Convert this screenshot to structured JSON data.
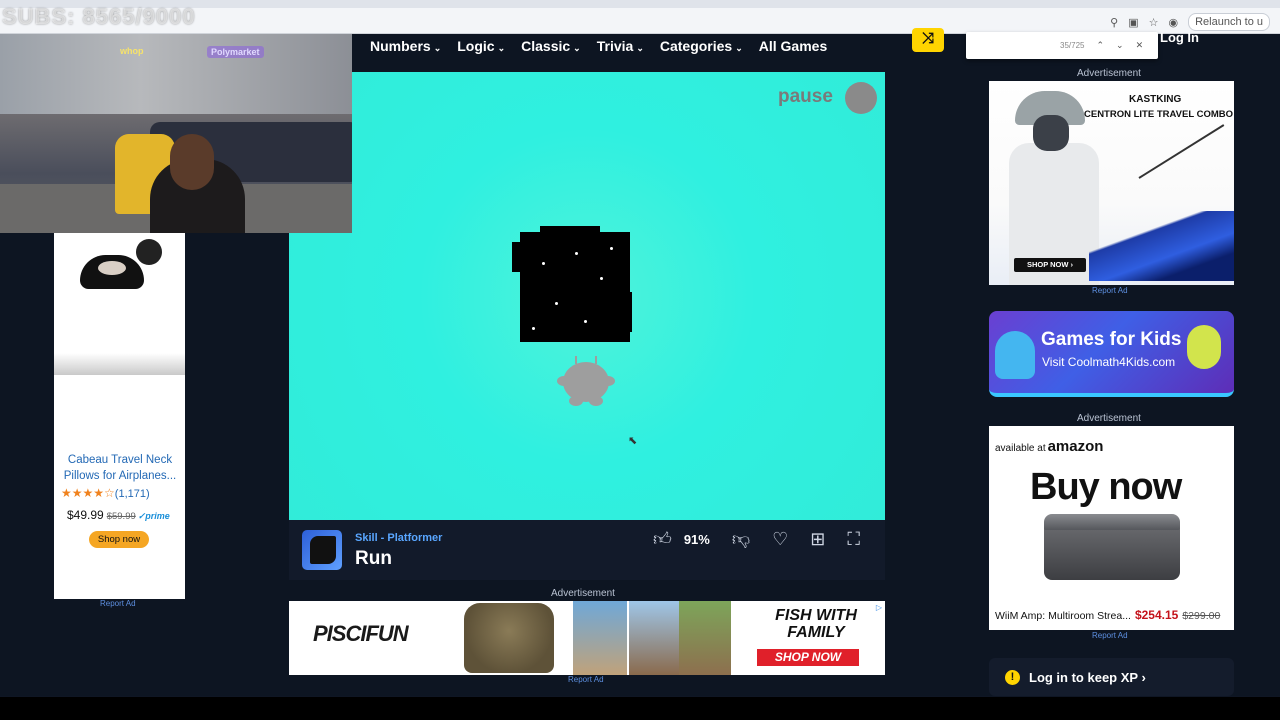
{
  "overlay": {
    "subs_counter": "SUBS: 8565/9000"
  },
  "browser": {
    "relaunch_label": "Relaunch to u",
    "find": {
      "count": "35/725",
      "prev": "⌃",
      "next": "⌄",
      "close": "✕"
    }
  },
  "nav": {
    "items": [
      {
        "label": "Numbers"
      },
      {
        "label": "Logic"
      },
      {
        "label": "Classic"
      },
      {
        "label": "Trivia"
      },
      {
        "label": "Categories"
      },
      {
        "label": "All Games"
      }
    ],
    "shuffle_glyph": "⤨",
    "login": "Log In"
  },
  "webcam": {
    "logo1": "whop",
    "logo2": "Polymarket"
  },
  "left_ad": {
    "product_title": "Cabeau Travel Neck Pillows for Airplanes...",
    "stars": "★★★★☆",
    "rating_count": "(1,171)",
    "price": "$49.99",
    "old_price": "$59.99",
    "prime": "✓prime",
    "shop_label": "Shop now",
    "report": "Report Ad"
  },
  "game": {
    "pause_label": "pause",
    "categories": "Skill - Platformer",
    "title": "Run",
    "like_percent": "91%",
    "colors": {
      "background": "#31ecd9",
      "accent": "#ffd400"
    }
  },
  "ads": {
    "advertisement_label": "Advertisement",
    "report": "Report Ad",
    "bottom": {
      "brand": "PISCIFUN",
      "headline": "FISH WITH FAMILY",
      "cta": "SHOP NOW",
      "choice": "▷"
    },
    "right1": {
      "brand": "KASTKING",
      "product": "CENTRON LITE TRAVEL COMBO",
      "cta": "SHOP NOW ›"
    },
    "kids": {
      "title": "Games for Kids",
      "subtitle": "Visit Coolmath4Kids.com"
    },
    "amazon": {
      "available_at": "available at",
      "brand": "amazon",
      "headline": "Buy now",
      "product": "WiiM Amp: Multiroom Strea...",
      "price": "$254.15",
      "old_price": "$299.00"
    }
  },
  "xp_prompt": "Log in to keep XP ›"
}
